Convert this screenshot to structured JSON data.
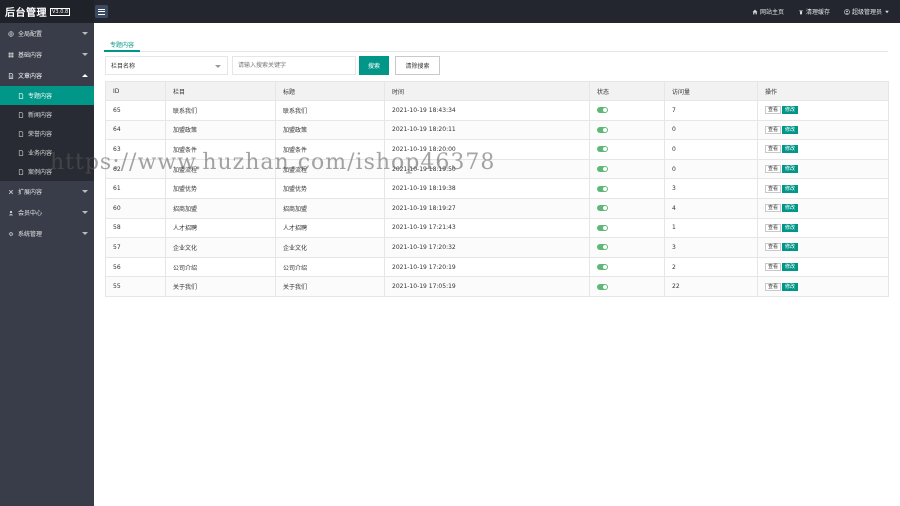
{
  "app": {
    "title": "后台管理",
    "version": "V3.0.8"
  },
  "header": {
    "links": [
      {
        "label": "网站主页",
        "icon": "home-icon"
      },
      {
        "label": "清理缓存",
        "icon": "trash-icon"
      },
      {
        "label": "超级管理员",
        "icon": "user-icon"
      }
    ]
  },
  "sidebar": {
    "groups": [
      {
        "label": "全局配置",
        "icon": "globe-icon",
        "open": false
      },
      {
        "label": "基础内容",
        "icon": "grid-icon",
        "open": false
      },
      {
        "label": "文章内容",
        "icon": "document-icon",
        "open": true,
        "items": [
          {
            "label": "专题内容",
            "active": true
          },
          {
            "label": "新闻内容",
            "active": false
          },
          {
            "label": "荣誉内容",
            "active": false
          },
          {
            "label": "业务内容",
            "active": false
          },
          {
            "label": "案例内容",
            "active": false
          }
        ]
      },
      {
        "label": "扩展内容",
        "icon": "puzzle-icon",
        "open": false
      },
      {
        "label": "会员中心",
        "icon": "user-icon",
        "open": false
      },
      {
        "label": "系统管理",
        "icon": "gear-icon",
        "open": false
      }
    ]
  },
  "main": {
    "tab": "专题内容",
    "search": {
      "select_value": "栏目名称",
      "keyword_placeholder": "请输入搜索关键字",
      "search_label": "搜索",
      "clear_label": "清除搜索"
    },
    "table": {
      "columns": [
        "ID",
        "栏目",
        "标题",
        "时间",
        "状态",
        "访问量",
        "操作"
      ],
      "view_label": "查看",
      "edit_label": "修改",
      "rows": [
        {
          "id": "65",
          "column": "联系我们",
          "title": "联系我们",
          "time": "2021-10-19 18:43:34",
          "status": true,
          "visits": "7"
        },
        {
          "id": "64",
          "column": "加盟政策",
          "title": "加盟政策",
          "time": "2021-10-19 18:20:11",
          "status": true,
          "visits": "0"
        },
        {
          "id": "63",
          "column": "加盟条件",
          "title": "加盟条件",
          "time": "2021-10-19 18:20:00",
          "status": true,
          "visits": "0"
        },
        {
          "id": "62",
          "column": "加盟流程",
          "title": "加盟流程",
          "time": "2021-10-19 18:19:50",
          "status": true,
          "visits": "0"
        },
        {
          "id": "61",
          "column": "加盟优势",
          "title": "加盟优势",
          "time": "2021-10-19 18:19:38",
          "status": true,
          "visits": "3"
        },
        {
          "id": "60",
          "column": "招商加盟",
          "title": "招商加盟",
          "time": "2021-10-19 18:19:27",
          "status": true,
          "visits": "4"
        },
        {
          "id": "58",
          "column": "人才招聘",
          "title": "人才招聘",
          "time": "2021-10-19 17:21:43",
          "status": true,
          "visits": "1"
        },
        {
          "id": "57",
          "column": "企业文化",
          "title": "企业文化",
          "time": "2021-10-19 17:20:32",
          "status": true,
          "visits": "3"
        },
        {
          "id": "56",
          "column": "公司介绍",
          "title": "公司介绍",
          "time": "2021-10-19 17:20:19",
          "status": true,
          "visits": "2"
        },
        {
          "id": "55",
          "column": "关于我们",
          "title": "关于我们",
          "time": "2021-10-19 17:05:19",
          "status": true,
          "visits": "22"
        }
      ]
    }
  },
  "watermark": "https://www.huzhan.com/ishop46378",
  "colors": {
    "accent": "#009688",
    "switch_on": "#5fb878",
    "sidebar": "#393d49",
    "topbar": "#23262e"
  }
}
